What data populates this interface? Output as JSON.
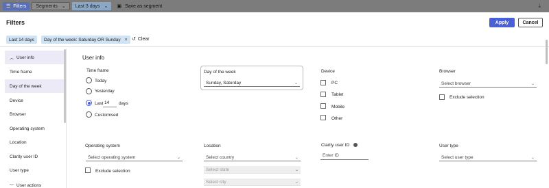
{
  "topbar": {
    "filters_label": "Filters",
    "segments_label": "Segments",
    "days_label": "Last 3 days",
    "save_label": "Save as segment"
  },
  "modal": {
    "title": "Filters",
    "apply_label": "Apply",
    "cancel_label": "Cancel",
    "chips": [
      "Last 14 days",
      "Day of the week: Saturday OR Sunday"
    ],
    "clear_label": "Clear"
  },
  "sidebar": {
    "items": [
      {
        "label": "User info",
        "expanded": true
      },
      {
        "label": "Time frame"
      },
      {
        "label": "Day of the week"
      },
      {
        "label": "Device"
      },
      {
        "label": "Browser"
      },
      {
        "label": "Operating system"
      },
      {
        "label": "Location"
      },
      {
        "label": "Clarity user ID"
      },
      {
        "label": "User type"
      },
      {
        "label": "User actions",
        "expanded": false
      }
    ],
    "active": "Day of the week"
  },
  "user_info": {
    "title": "User info",
    "time_frame": {
      "label": "Time frame",
      "options": [
        "Today",
        "Yesterday",
        "Last",
        "Customised"
      ],
      "selected": "Last",
      "last_value": "14",
      "days_suffix": "days"
    },
    "day_of_week": {
      "label": "Day of the week",
      "value": "Sunday, Saturday"
    },
    "device": {
      "label": "Device",
      "options": [
        "PC",
        "Tablet",
        "Mobile",
        "Other"
      ]
    },
    "browser": {
      "label": "Browser",
      "placeholder": "Select browser",
      "exclude_label": "Exclude selection"
    },
    "operating_system": {
      "label": "Operating system",
      "placeholder": "Select operating system",
      "exclude_label": "Exclude selection"
    },
    "location": {
      "label": "Location",
      "country_placeholder": "Select country",
      "state_placeholder": "Select state",
      "city_placeholder": "Select city"
    },
    "clarity_user_id": {
      "label": "Clarity user ID",
      "placeholder": "Enter ID"
    },
    "user_type": {
      "label": "User type",
      "placeholder": "Select user type"
    }
  },
  "colors": {
    "accent": "#4a61d6",
    "chip_bg": "#cfe3f4",
    "active_bg": "#ebeaf6"
  }
}
